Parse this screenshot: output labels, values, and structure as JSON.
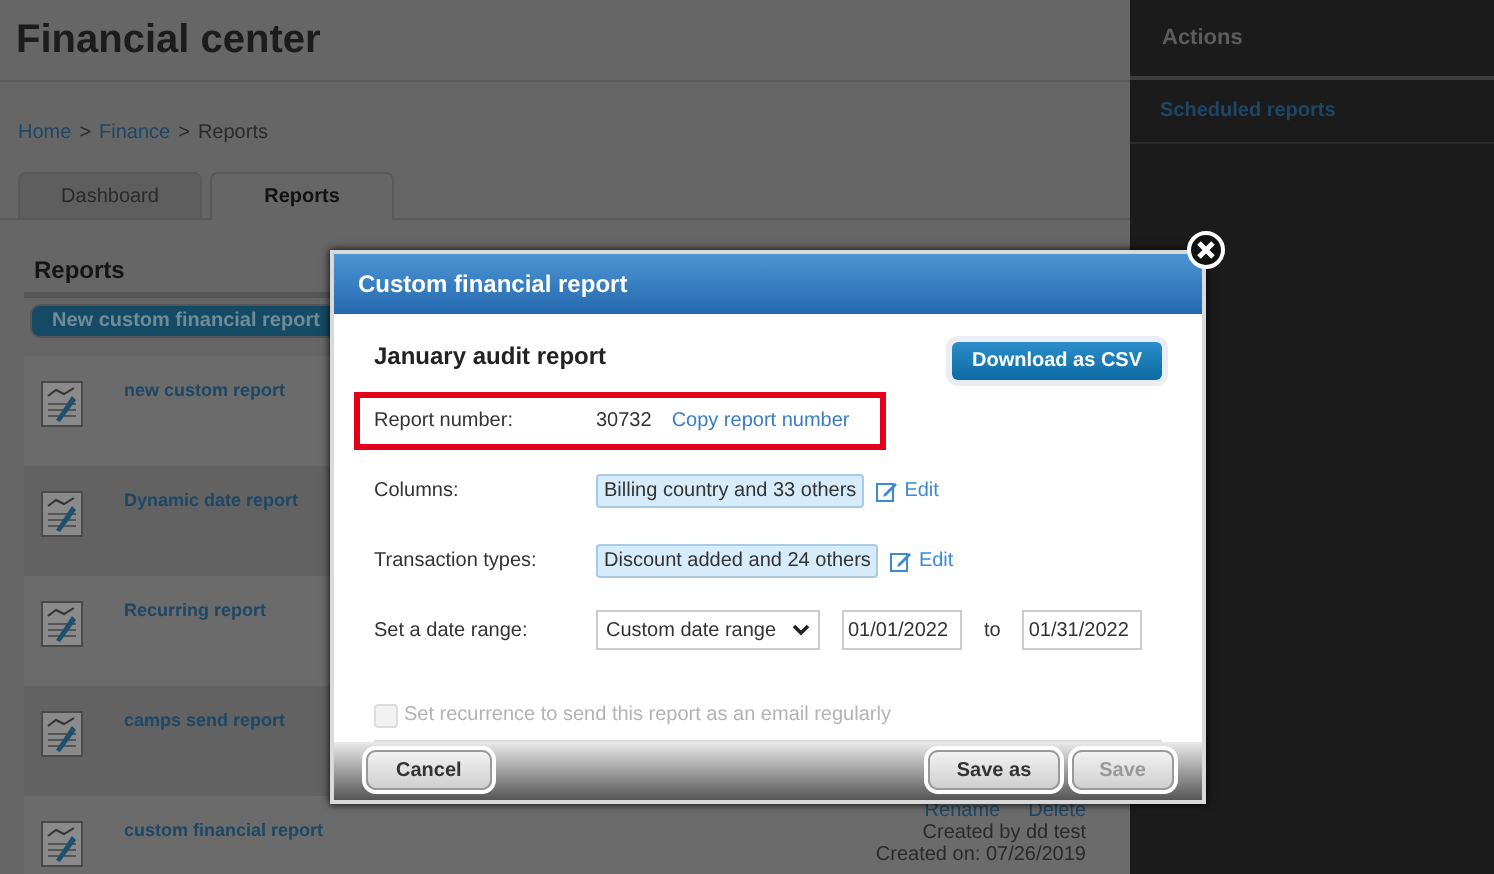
{
  "page": {
    "title": "Financial center",
    "breadcrumb": [
      {
        "label": "Home",
        "link": true
      },
      {
        "label": "Finance",
        "link": true
      },
      {
        "label": "Reports",
        "link": false
      }
    ],
    "separator": ">",
    "tabs": [
      {
        "label": "Dashboard",
        "selected": false
      },
      {
        "label": "Reports",
        "selected": true
      }
    ],
    "reports": {
      "heading": "Reports",
      "new_button": "New custom financial report",
      "rows": [
        {
          "name": "new custom report"
        },
        {
          "name": "Dynamic date report"
        },
        {
          "name": "Recurring report"
        },
        {
          "name": "camps send report"
        },
        {
          "name": "custom financial report",
          "actions": [
            "Rename",
            "Delete"
          ],
          "created_by": "Created by dd test",
          "created_on": "Created on: 07/26/2019"
        }
      ]
    }
  },
  "sidebar": {
    "heading": "Actions",
    "links": [
      "Scheduled reports"
    ]
  },
  "modal": {
    "title": "Custom financial report",
    "report_name": "January audit report",
    "download_button": "Download as CSV",
    "fields": [
      {
        "kind": "number",
        "label": "Report number:",
        "value": "30732",
        "link": "Copy report number",
        "highlighted": true
      },
      {
        "kind": "tags",
        "label": "Columns:",
        "tag": "Billing country and 33 others",
        "edit": "Edit",
        "highlighted": false
      },
      {
        "kind": "tags",
        "label": "Transaction types:",
        "tag": "Discount added and 24 others",
        "edit": "Edit",
        "highlighted": false
      },
      {
        "kind": "date_range",
        "label": "Set a date range:",
        "select": "Custom date range",
        "from": "01/01/2022",
        "to_word": "to",
        "to": "01/31/2022",
        "highlighted": false
      }
    ],
    "recurrence": {
      "label": "Set recurrence to send this report as an email regularly",
      "checked": false,
      "disabled": true
    },
    "buttons": [
      {
        "label": "Cancel",
        "disabled": false
      },
      {
        "label": "Save as",
        "disabled": false
      },
      {
        "label": "Save",
        "disabled": true
      }
    ]
  }
}
